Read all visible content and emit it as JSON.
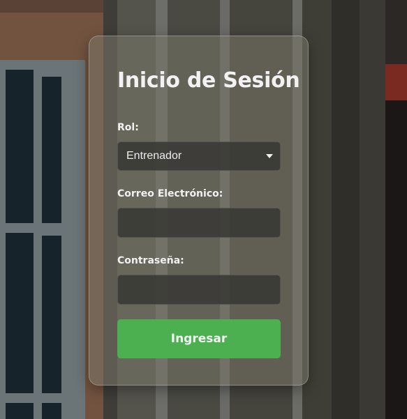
{
  "login": {
    "title": "Inicio de Sesión",
    "role": {
      "label": "Rol:",
      "selected": "Entrenador"
    },
    "email": {
      "label": "Correo Electrónico:",
      "value": ""
    },
    "password": {
      "label": "Contraseña:",
      "value": ""
    },
    "submit_label": "Ingresar"
  },
  "colors": {
    "accent": "#4caf50",
    "card_bg": "#787668",
    "text": "#f2f2f2"
  },
  "icons": {
    "select_caret": "caret-down-icon"
  }
}
